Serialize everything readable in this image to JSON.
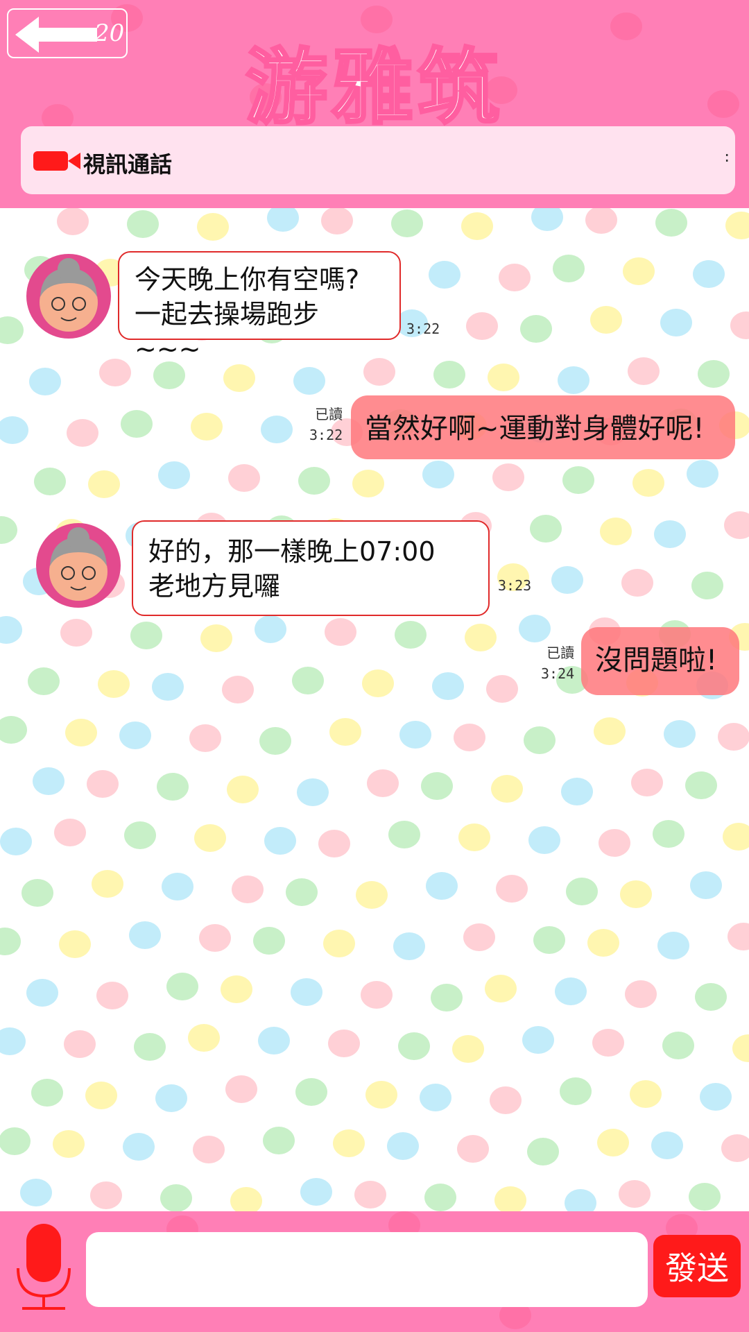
{
  "header": {
    "back_count": "20",
    "title": "游雅筑",
    "video_call_label": "視訊通話",
    "icons": [
      "back-arrow-icon",
      "video-camera-icon",
      "more-options-icon"
    ]
  },
  "messages": [
    {
      "direction": "incoming",
      "lines": [
        "今天晚上你有空嗎?",
        "一起去操場跑步~~~"
      ],
      "time": "3:22"
    },
    {
      "direction": "outgoing",
      "text": "當然好啊~運動對身體好呢!",
      "read": "已讀",
      "time": "3:22"
    },
    {
      "direction": "incoming",
      "lines": [
        "好的，那一樣晚上07:00",
        "老地方見囉"
      ],
      "time": "3:23"
    },
    {
      "direction": "outgoing",
      "text": "沒問題啦!",
      "read": "已讀",
      "time": "3:24"
    }
  ],
  "composer": {
    "input_value": "",
    "send_label": "發送",
    "icons": [
      "microphone-icon"
    ]
  },
  "colors": {
    "header_pink": "#ff7fb6",
    "title_outline": "#ff5ea0",
    "video_bar_bg": "#ffe2ef",
    "incoming_border": "#e02a2a",
    "outgoing_bg": "#ff787d",
    "send_button": "#ff1a1a",
    "mic_red": "#ff1a1a"
  }
}
